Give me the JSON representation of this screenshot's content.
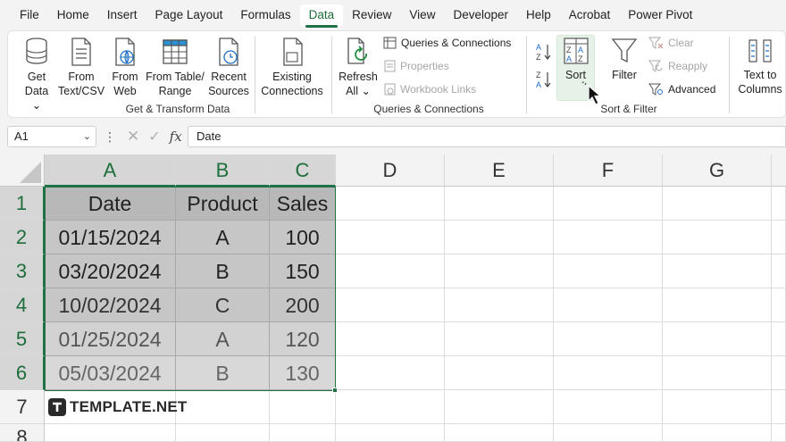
{
  "menu": [
    "File",
    "Home",
    "Insert",
    "Page Layout",
    "Formulas",
    "Data",
    "Review",
    "View",
    "Developer",
    "Help",
    "Acrobat",
    "Power Pivot"
  ],
  "ribbon": {
    "get_data": [
      "Get",
      "Data ⌄"
    ],
    "from_text": [
      "From",
      "Text/CSV"
    ],
    "from_web": [
      "From",
      "Web"
    ],
    "from_table": [
      "From Table/",
      "Range"
    ],
    "recent_sources": [
      "Recent",
      "Sources"
    ],
    "existing_connections": [
      "Existing",
      "Connections"
    ],
    "refresh_all": [
      "Refresh",
      "All ⌄"
    ],
    "queries_connections": "Queries & Connections",
    "properties": "Properties",
    "workbook_links": "Workbook Links",
    "sort": "Sort",
    "filter": "Filter",
    "clear": "Clear",
    "reapply": "Reapply",
    "advanced": "Advanced",
    "text_to_columns": [
      "Text to",
      "Columns"
    ],
    "groups": [
      "Get & Transform Data",
      "Queries & Connections",
      "Sort & Filter"
    ]
  },
  "formula_bar": {
    "name_box": "A1",
    "value": "Date",
    "fx": "fx"
  },
  "columns": [
    "A",
    "B",
    "C",
    "D",
    "E",
    "F",
    "G"
  ],
  "rows": [
    "1",
    "2",
    "3",
    "4",
    "5",
    "6",
    "7",
    "8"
  ],
  "table": {
    "headers": [
      "Date",
      "Product",
      "Sales"
    ],
    "rows": [
      [
        "01/15/2024",
        "A",
        "100"
      ],
      [
        "03/20/2024",
        "B",
        "150"
      ],
      [
        "10/02/2024",
        "C",
        "200"
      ],
      [
        "01/25/2024",
        "A",
        "120"
      ],
      [
        "05/03/2024",
        "B",
        "130"
      ]
    ]
  },
  "watermark": "TEMPLATE.NET",
  "colors": {
    "accent": "#217346",
    "ribbon_bg": "#ffffff",
    "chrome_bg": "#f3f3f3"
  }
}
